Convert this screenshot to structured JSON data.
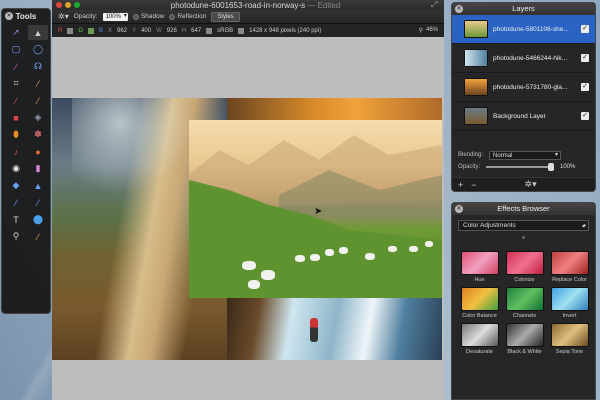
{
  "document": {
    "title": "photodune-6001653-road-in-norway-s",
    "edited": "— Edited"
  },
  "toolbar": {
    "opacity_label": "Opacity:",
    "opacity_value": "100%",
    "shadow_label": "Shadow",
    "reflection_label": "Reflection",
    "styles_label": "Styles"
  },
  "infobar": {
    "r_label": "R",
    "g_label": "G",
    "b_label": "B",
    "x_label": "X",
    "x_value": "962",
    "y_label": "Y",
    "y_value": "400",
    "w_label": "W",
    "w_value": "926",
    "h_label": "H",
    "h_value": "647",
    "color_space": "sRGB",
    "size_text": "1428 x 948 pixels (240 ppi)",
    "zoom": "46%"
  },
  "tools": {
    "title": "Tools",
    "items": [
      {
        "icon": "arrow-select-icon",
        "glyph": "➚",
        "color": "#9a7bd8"
      },
      {
        "icon": "move-pointer-icon",
        "glyph": "▲",
        "color": "#d0d0d0"
      },
      {
        "icon": "rect-select-icon",
        "glyph": "▢",
        "color": "#7aa7ff"
      },
      {
        "icon": "ellipse-select-icon",
        "glyph": "◯",
        "color": "#7aa7ff"
      },
      {
        "icon": "magic-wand-icon",
        "glyph": "⁄",
        "color": "#d060d0"
      },
      {
        "icon": "lasso-icon",
        "glyph": "☊",
        "color": "#7aa7ff"
      },
      {
        "icon": "crop-icon",
        "glyph": "⌗",
        "color": "#cfcfcf"
      },
      {
        "icon": "eyedropper-icon",
        "glyph": "⁄",
        "color": "#e0b040"
      },
      {
        "icon": "brush-icon",
        "glyph": "⁄",
        "color": "#e05050"
      },
      {
        "icon": "pencil-icon",
        "glyph": "⁄",
        "color": "#e0a040"
      },
      {
        "icon": "eraser-icon",
        "glyph": "■",
        "color": "#e04848"
      },
      {
        "icon": "paint-bucket-icon",
        "glyph": "◈",
        "color": "#9aa0b0"
      },
      {
        "icon": "smudge-icon",
        "glyph": "⬮",
        "color": "#e89020"
      },
      {
        "icon": "clone-icon",
        "glyph": "✽",
        "color": "#e07070"
      },
      {
        "icon": "burn-icon",
        "glyph": "♪",
        "color": "#e06030"
      },
      {
        "icon": "dodge-icon",
        "glyph": "●",
        "color": "#e07030"
      },
      {
        "icon": "red-eye-icon",
        "glyph": "◉",
        "color": "#e8e8e8"
      },
      {
        "icon": "bandage-icon",
        "glyph": "▮",
        "color": "#d888d8"
      },
      {
        "icon": "blur-icon",
        "glyph": "◆",
        "color": "#6aa0ff"
      },
      {
        "icon": "sharpen-icon",
        "glyph": "▲",
        "color": "#6aa0ff"
      },
      {
        "icon": "pen-icon",
        "glyph": "⁄",
        "color": "#6aa0ff"
      },
      {
        "icon": "line-icon",
        "glyph": "⁄",
        "color": "#6aa0ff"
      },
      {
        "icon": "text-icon",
        "glyph": "T",
        "color": "#dddddd"
      },
      {
        "icon": "shape-icon",
        "glyph": "⬤",
        "color": "#4aa0e8"
      },
      {
        "icon": "zoom-icon",
        "glyph": "⚲",
        "color": "#cfcfcf"
      },
      {
        "icon": "color-picker-icon",
        "glyph": "⁄",
        "color": "#e0b040"
      }
    ]
  },
  "layers": {
    "title": "Layers",
    "items": [
      {
        "name": "photodune-5801106-she...",
        "selected": true,
        "thumb": "linear-gradient(#e9c991,#6f9a38)"
      },
      {
        "name": "photodune-5466244-hik...",
        "selected": false,
        "thumb": "linear-gradient(90deg,#cfe6ef,#4f7f9f)"
      },
      {
        "name": "photodune-5731780-gla...",
        "selected": false,
        "thumb": "linear-gradient(#f0a23a,#6a4520)"
      },
      {
        "name": "Background Layer",
        "selected": false,
        "thumb": "linear-gradient(#6a7b87,#7a5a2e)"
      }
    ],
    "blending_label": "Blending:",
    "blending_value": "Normal",
    "opacity_label": "Opacity:",
    "opacity_value": "100%",
    "opacity_fraction": 1.0
  },
  "effects": {
    "title": "Effects Browser",
    "category": "Color Adjustments",
    "items": [
      {
        "label": "Hue",
        "swatch": "linear-gradient(135deg,#e05070,#f0a0c0,#d04060)"
      },
      {
        "label": "Colorize",
        "swatch": "linear-gradient(135deg,#d03050,#f07090,#c02040)"
      },
      {
        "label": "Replace Color",
        "swatch": "linear-gradient(135deg,#c04040,#f08080,#a02020)"
      },
      {
        "label": "Color Balance",
        "swatch": "linear-gradient(135deg,#e08020,#f0c040,#40a040)"
      },
      {
        "label": "Channels",
        "swatch": "linear-gradient(135deg,#208040,#60c060,#107030)"
      },
      {
        "label": "Invert",
        "swatch": "linear-gradient(135deg,#40a0e0,#a0e0f0,#3080c0)"
      },
      {
        "label": "Desaturate",
        "swatch": "linear-gradient(135deg,#777,#ddd,#555)"
      },
      {
        "label": "Black & White",
        "swatch": "linear-gradient(135deg,#333,#aaa,#222)"
      },
      {
        "label": "Sepia Tone",
        "swatch": "linear-gradient(135deg,#8a6a30,#e0c080,#6a4a20)"
      }
    ]
  }
}
